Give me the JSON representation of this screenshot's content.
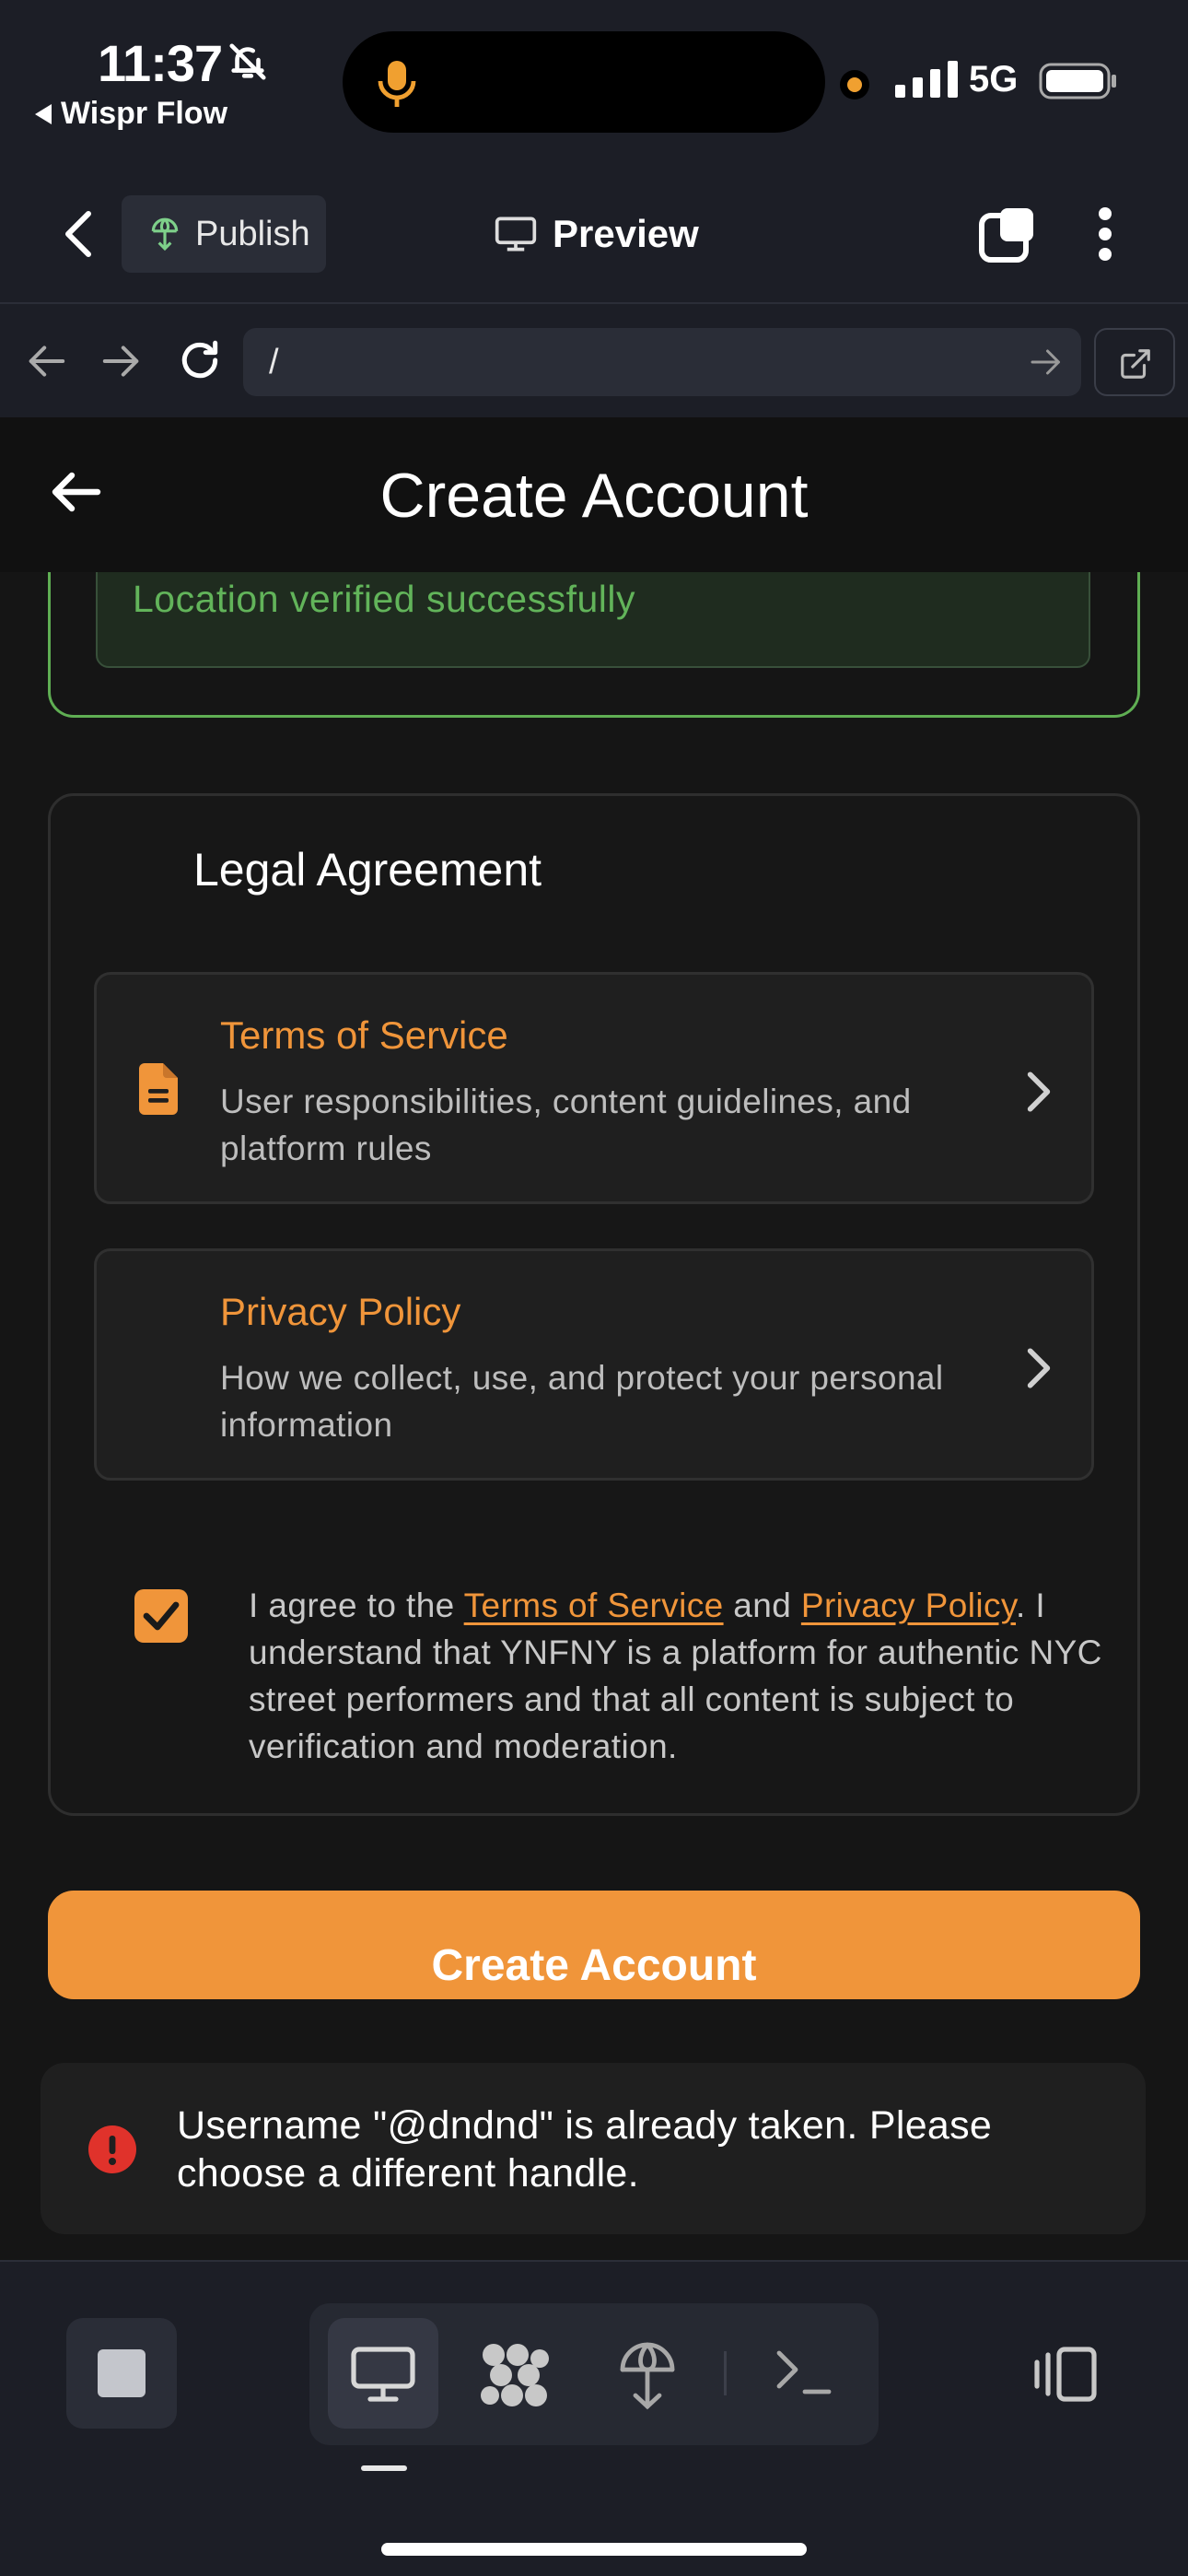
{
  "status_bar": {
    "time": "11:37",
    "back_app": "Wispr Flow",
    "network": "5G",
    "recording_dot_color": "#f0a030"
  },
  "chrome": {
    "publish_label": "Publish",
    "preview_label": "Preview",
    "url": "/"
  },
  "app": {
    "title": "Create Account",
    "location_status": "Location verified successfully",
    "legal": {
      "title": "Legal Agreement",
      "tos": {
        "title": "Terms of Service",
        "description": "User responsibilities, content guidelines, and platform rules",
        "icon": "document-icon"
      },
      "privacy": {
        "title": "Privacy Policy",
        "description": "How we collect, use, and protect your personal information"
      },
      "agree": {
        "checked": true,
        "prefix": "I agree to the ",
        "tos_link": "Terms of Service",
        "and": " and ",
        "privacy_link": "Privacy Policy",
        "suffix": ". I understand that YNFNY is a platform for authentic NYC street performers and that all content is subject to verification and moderation."
      }
    },
    "submit_label": "Create Account",
    "error": "Username \"@dndnd\" is already taken. Please choose a different handle."
  },
  "colors": {
    "accent": "#f0953a",
    "success": "#62b45a",
    "error": "#e0322b",
    "background": "#151515"
  }
}
